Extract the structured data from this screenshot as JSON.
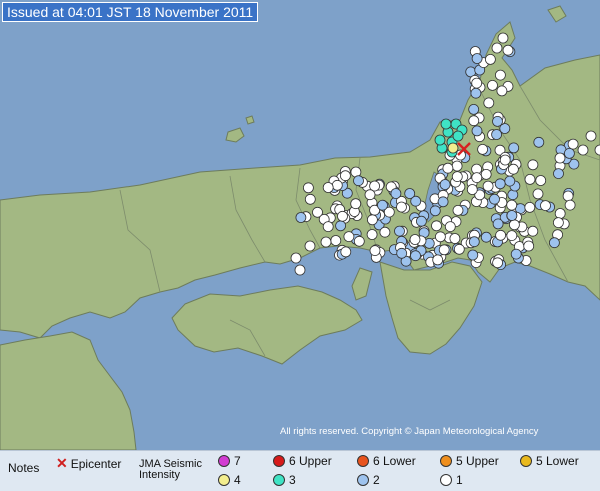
{
  "title": "Issued at 04:01 JST  18 November 2011",
  "copyright": "All rights reserved. Copyright © Japan Meteorological Agency",
  "legend": {
    "notes": "Notes",
    "epicenter": "Epicenter",
    "jma_line1": "JMA Seismic",
    "jma_line2": "Intensity",
    "items": [
      {
        "label": "7",
        "color": "#d23cd2"
      },
      {
        "label": "6 Upper",
        "color": "#d61a1a"
      },
      {
        "label": "6 Lower",
        "color": "#e8541f"
      },
      {
        "label": "5 Upper",
        "color": "#ef8f1e"
      },
      {
        "label": "5 Lower",
        "color": "#e9b91e"
      },
      {
        "label": "4",
        "color": "#f3ee8e"
      },
      {
        "label": "3",
        "color": "#3fe3c5"
      },
      {
        "label": "2",
        "color": "#9ec3ee"
      },
      {
        "label": "1",
        "color": "#ffffff"
      }
    ]
  },
  "colors": {
    "sea": "#7ea1c9",
    "land": "#a3b883",
    "epicenter": "#d62020"
  }
}
